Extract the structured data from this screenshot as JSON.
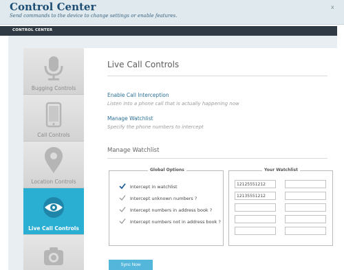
{
  "header": {
    "title": "Control Center",
    "subtitle": "Send commands to the device to change settings or enable features.",
    "close_glyph": "x"
  },
  "bar": {
    "label": "CONTROL CENTER"
  },
  "sidebar": {
    "items": [
      {
        "label": "Bugging Controls",
        "icon": "microphone-icon",
        "active": false
      },
      {
        "label": "Call Controls",
        "icon": "phone-icon",
        "active": false
      },
      {
        "label": "Location Controls",
        "icon": "location-pin-icon",
        "active": false
      },
      {
        "label": "Live Call Controls",
        "icon": "eye-icon",
        "active": true
      },
      {
        "label": "",
        "icon": "camera-icon",
        "active": false
      }
    ]
  },
  "main": {
    "title": "Live Call Controls",
    "enable_link": "Enable Call Interception",
    "enable_desc": "Listen into a phone call that is actually happening now",
    "watchlist_link": "Manage Watchlist",
    "watchlist_desc": "Specify the phone numbers to intercept",
    "section_title": "Manage Watchlist"
  },
  "global_options": {
    "legend": "Global Options",
    "options": [
      {
        "label": "Intercept in watchlist",
        "checked": true
      },
      {
        "label": "Intercept unknown numbers ?",
        "checked": false
      },
      {
        "label": "Intercept numbers in address book ?",
        "checked": false
      },
      {
        "label": "Intercept numbers not in address book ?",
        "checked": false
      }
    ]
  },
  "watchlist": {
    "legend": "Your Watchlist",
    "entries": [
      "12125551212",
      "",
      "12135551212",
      "",
      "",
      "",
      "",
      "",
      "",
      ""
    ]
  },
  "sync_button": "Sync Now",
  "colors": {
    "accent": "#2aaed2",
    "link": "#2a6f97",
    "bar": "#2f3a44",
    "check_active": "#1f5e9a",
    "check_inactive": "#9e9e9e"
  }
}
